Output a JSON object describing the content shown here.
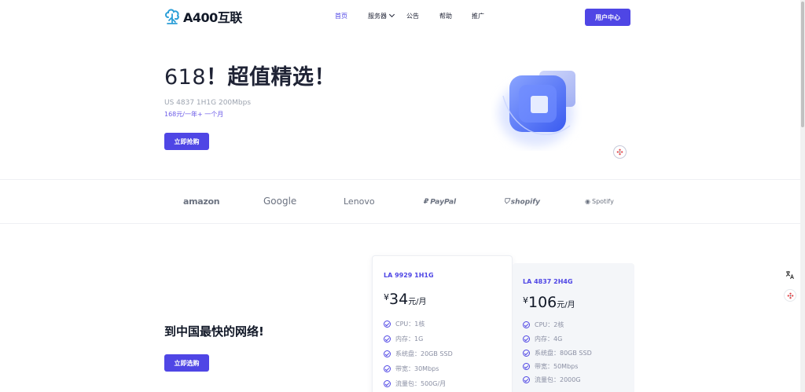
{
  "header": {
    "logo_text": "A400互联",
    "nav": [
      {
        "label": "首页",
        "active": true
      },
      {
        "label": "服务器",
        "dropdown": true
      },
      {
        "label": "公告"
      },
      {
        "label": "帮助"
      },
      {
        "label": "推广"
      }
    ],
    "user_center": "用户中心"
  },
  "hero": {
    "title_num": "618",
    "title_text": "！超值精选！",
    "subtitle": "US 4837 1H1G 200Mbps",
    "price_line": "168元/一年+ 一个月",
    "buy_label": "立即抢购"
  },
  "brands": [
    "amazon",
    "Google",
    "Lenovo",
    "PayPal",
    "shopify",
    "Spotify"
  ],
  "section": {
    "title": "到中国最快的网络!",
    "button": "立即选购"
  },
  "plans": [
    {
      "name": "LA 9929 1H1G",
      "currency": "¥",
      "price": "34",
      "unit": "元/月",
      "features": [
        "CPU：1核",
        "内存：1G",
        "系统盘：20GB SSD",
        "带宽：30Mbps",
        "流量包：500G/月"
      ]
    },
    {
      "name": "LA 4837 2H4G",
      "currency": "¥",
      "price": "106",
      "unit": "元/月",
      "features": [
        "CPU：2核",
        "内存：4G",
        "系统盘：80GB SSD",
        "带宽：50Mbps",
        "流量包：2000G"
      ]
    }
  ],
  "colors": {
    "accent": "#4f46e5",
    "text_dark": "#1f2335",
    "muted": "#9ca3af"
  },
  "icons": {
    "logo": "cloud-tree-icon",
    "dropdown": "chevron-down-icon",
    "check": "check-circle-icon",
    "translate": "translate-icon",
    "float_badge": "flower-icon"
  }
}
